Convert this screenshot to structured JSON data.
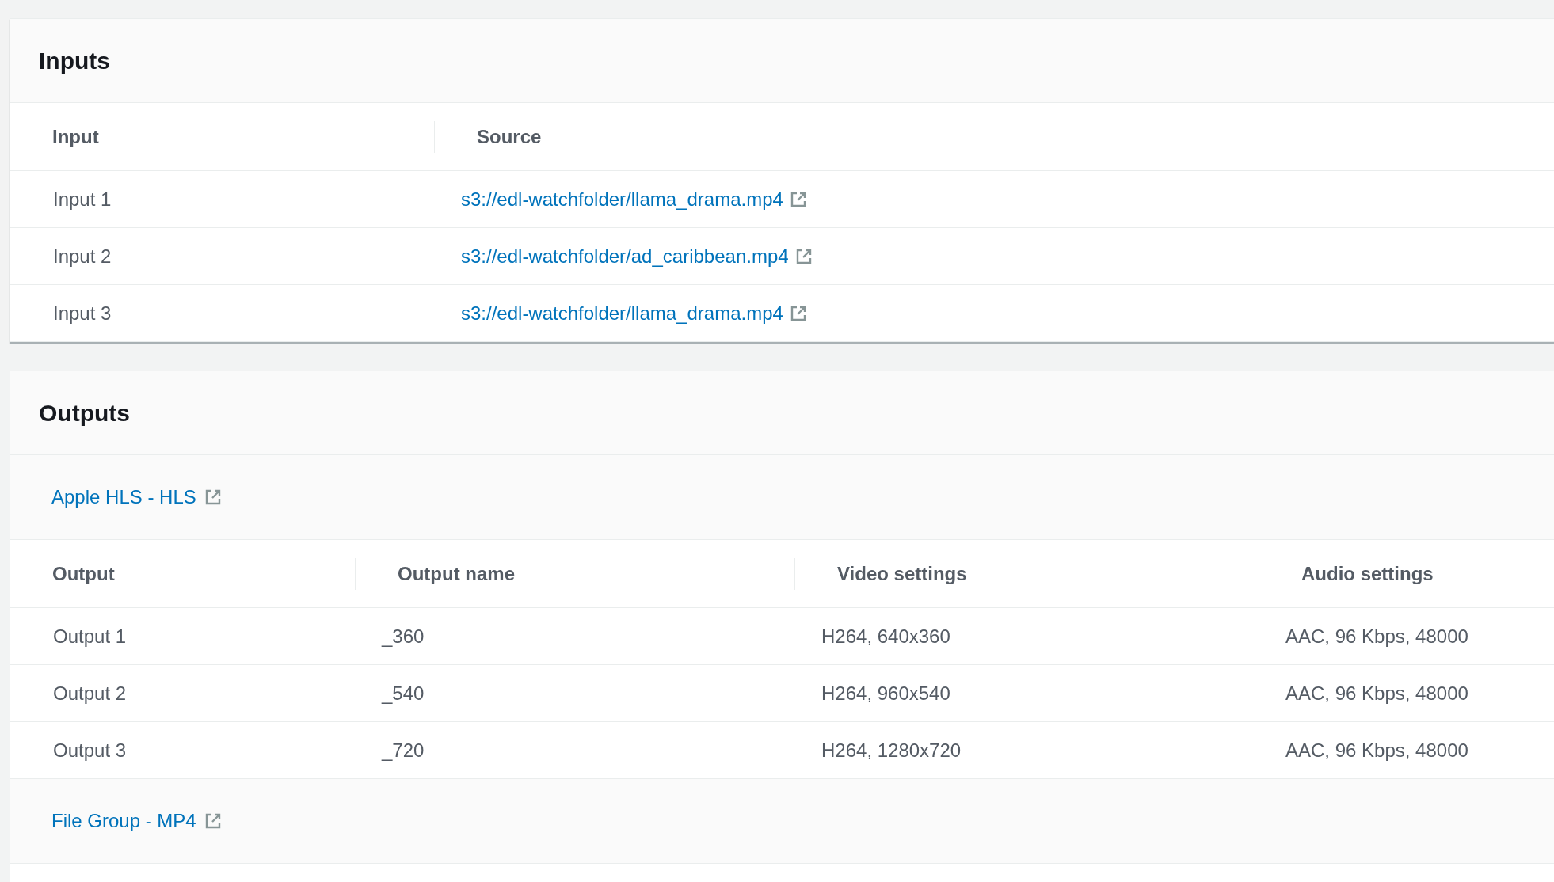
{
  "inputs": {
    "title": "Inputs",
    "columns": [
      "Input",
      "Source"
    ],
    "rows": [
      {
        "input": "Input 1",
        "source": "s3://edl-watchfolder/llama_drama.mp4"
      },
      {
        "input": "Input 2",
        "source": "s3://edl-watchfolder/ad_caribbean.mp4"
      },
      {
        "input": "Input 3",
        "source": "s3://edl-watchfolder/llama_drama.mp4"
      }
    ]
  },
  "outputs": {
    "title": "Outputs",
    "groups": [
      {
        "name": "Apple HLS - HLS",
        "columns": [
          "Output",
          "Output name",
          "Video settings",
          "Audio settings"
        ],
        "rows": [
          {
            "output": "Output 1",
            "output_name": "_360",
            "video_settings": "H264, 640x360",
            "audio_settings": "AAC, 96 Kbps, 48000"
          },
          {
            "output": "Output 2",
            "output_name": "_540",
            "video_settings": "H264, 960x540",
            "audio_settings": "AAC, 96 Kbps, 48000"
          },
          {
            "output": "Output 3",
            "output_name": "_720",
            "video_settings": "H264, 1280x720",
            "audio_settings": "AAC, 96 Kbps, 48000"
          }
        ]
      },
      {
        "name": "File Group - MP4"
      }
    ]
  }
}
